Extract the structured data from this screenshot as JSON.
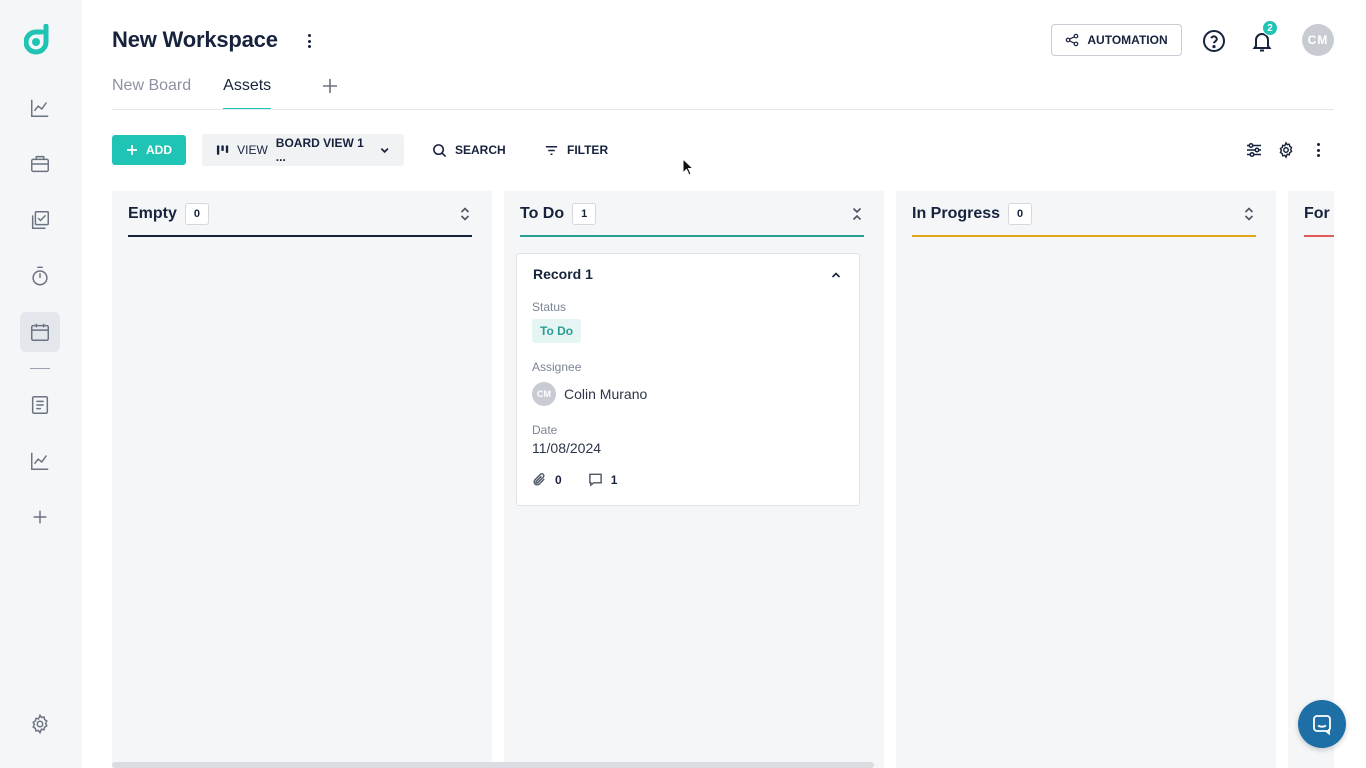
{
  "workspace": {
    "title": "New Workspace"
  },
  "header": {
    "automation_label": "AUTOMATION",
    "notification_count": "2",
    "user_initials": "CM"
  },
  "tabs": [
    {
      "label": "New Board",
      "active": false
    },
    {
      "label": "Assets",
      "active": true
    }
  ],
  "toolbar": {
    "add_label": "ADD",
    "view_prefix": "VIEW",
    "view_value": "BOARD VIEW 1 ...",
    "search_label": "SEARCH",
    "filter_label": "FILTER"
  },
  "sidebar": {
    "items": [
      {
        "icon": "chart-line-icon"
      },
      {
        "icon": "briefcase-icon"
      },
      {
        "icon": "checklist-icon"
      },
      {
        "icon": "stopwatch-icon"
      },
      {
        "icon": "calendar-icon",
        "active": true
      },
      {
        "icon": "document-icon"
      },
      {
        "icon": "chart-line-icon"
      },
      {
        "icon": "plus-icon"
      },
      {
        "icon": "gear-icon"
      }
    ]
  },
  "columns": [
    {
      "title": "Empty",
      "count": "0",
      "color": "#17233d"
    },
    {
      "title": "To Do",
      "count": "1",
      "color": "#2a9d94"
    },
    {
      "title": "In Progress",
      "count": "0",
      "color": "#e0a818"
    },
    {
      "title": "For",
      "count": "",
      "color": "#e05a5a"
    }
  ],
  "card": {
    "title": "Record 1",
    "status_label": "Status",
    "status_value": "To Do",
    "assignee_label": "Assignee",
    "assignee_initials": "CM",
    "assignee_name": "Colin Murano",
    "date_label": "Date",
    "date_value": "11/08/2024",
    "attachments": "0",
    "comments": "1"
  },
  "colors": {
    "accent": "#20c4b4",
    "chat": "#1d6fa5"
  }
}
